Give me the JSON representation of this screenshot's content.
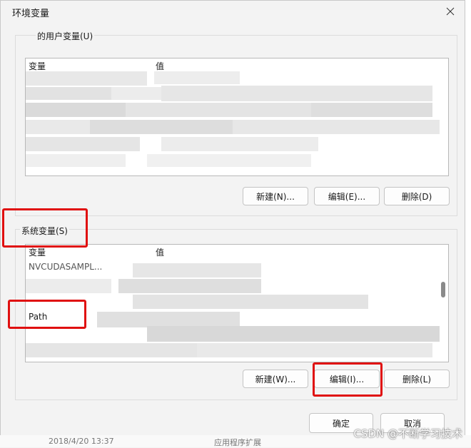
{
  "dialog": {
    "title": "环境变量",
    "close_glyph": "✕"
  },
  "user_vars": {
    "group_label": "的用户变量(U)",
    "col_variable": "变量",
    "col_value": "值",
    "buttons": {
      "new": "新建(N)...",
      "edit": "编辑(E)...",
      "delete": "删除(D)"
    }
  },
  "sys_vars": {
    "group_label": "系统变量(S)",
    "col_variable": "变量",
    "col_value": "值",
    "rows": [
      {
        "name": "NVCUDASAMPL..."
      },
      {
        "name": "Path"
      }
    ],
    "buttons": {
      "new": "新建(W)...",
      "edit": "编辑(I)...",
      "delete": "删除(L)"
    }
  },
  "footer": {
    "ok": "确定",
    "cancel": "取消"
  },
  "background": {
    "date": "2018/4/20 13:37",
    "type": "应用程序扩展"
  },
  "watermark": "CSDN @不断学习技术",
  "colors": {
    "highlight": "#e01010",
    "dialog_bg": "#f3f3f3"
  }
}
